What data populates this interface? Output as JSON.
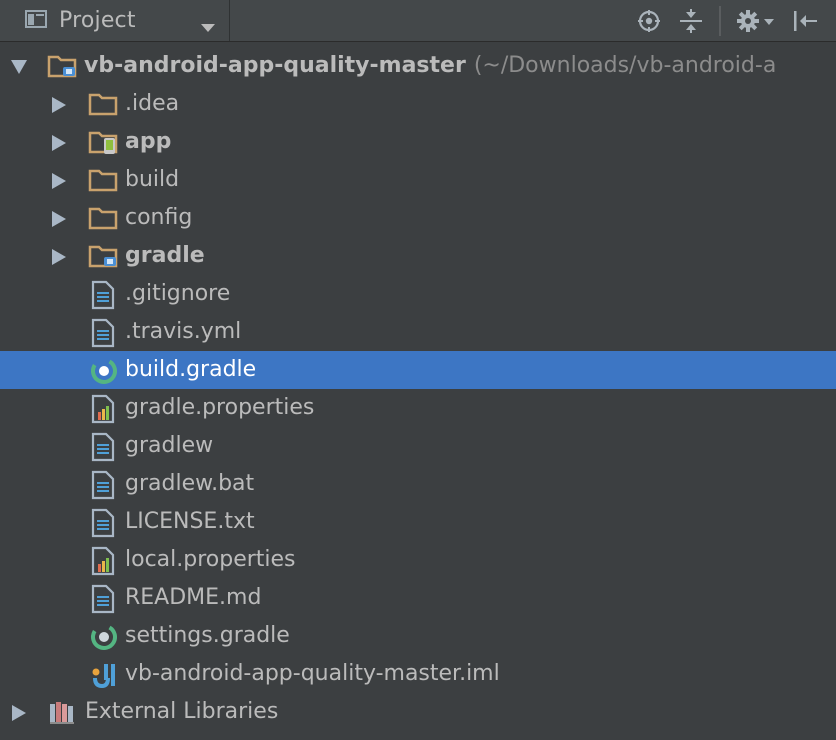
{
  "toolbar": {
    "title": "Project",
    "icons": [
      "project-view-icon",
      "dropdown-arrow-icon",
      "locate-icon",
      "collapse-all-icon",
      "settings-gear-icon",
      "hide-panel-icon"
    ]
  },
  "tree": {
    "root": {
      "label": "vb-android-app-quality-master",
      "path": "(~/Downloads/vb-android-a",
      "expanded": true
    },
    "items": [
      {
        "label": ".idea",
        "type": "folder",
        "bold": false
      },
      {
        "label": "app",
        "type": "module",
        "bold": true
      },
      {
        "label": "build",
        "type": "folder",
        "bold": false
      },
      {
        "label": "config",
        "type": "folder",
        "bold": false
      },
      {
        "label": "gradle",
        "type": "folder-special",
        "bold": true
      },
      {
        "label": ".gitignore",
        "type": "text"
      },
      {
        "label": ".travis.yml",
        "type": "text"
      },
      {
        "label": "build.gradle",
        "type": "gradle",
        "selected": true
      },
      {
        "label": "gradle.properties",
        "type": "properties"
      },
      {
        "label": "gradlew",
        "type": "text"
      },
      {
        "label": "gradlew.bat",
        "type": "text"
      },
      {
        "label": "LICENSE.txt",
        "type": "text"
      },
      {
        "label": "local.properties",
        "type": "properties"
      },
      {
        "label": "README.md",
        "type": "text"
      },
      {
        "label": "settings.gradle",
        "type": "gradle"
      },
      {
        "label": "vb-android-app-quality-master.iml",
        "type": "iml"
      }
    ],
    "external": {
      "label": "External Libraries"
    }
  },
  "colors": {
    "background": "#3c3f41",
    "toolbar": "#44484a",
    "selection": "#3d76c4",
    "text": "#bbbbbb",
    "folder": "#c9a26d",
    "gradle": "#54b582"
  }
}
